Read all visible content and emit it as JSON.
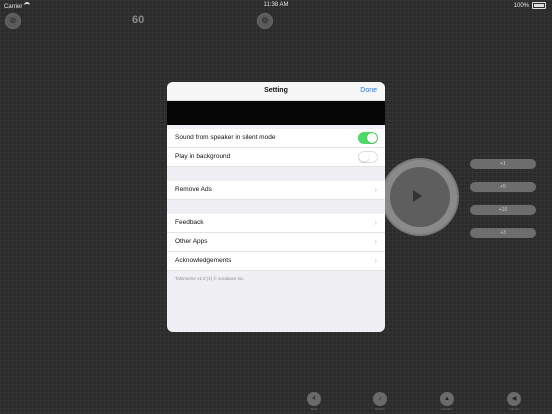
{
  "status_bar": {
    "carrier": "Carrier",
    "time": "11:38 AM",
    "battery": "100%"
  },
  "background": {
    "bpm": "60",
    "buttons": [
      "+1",
      "+5",
      "+10",
      "+3"
    ],
    "bottom_bar": [
      {
        "icon": "4",
        "label": "Beat"
      },
      {
        "icon": "♪",
        "label": "Rhythm"
      },
      {
        "icon": "▲",
        "label": "Variation"
      },
      {
        "icon": "◀",
        "label": "Volume"
      }
    ]
  },
  "settings": {
    "title": "Setting",
    "done_label": "Done",
    "rows": {
      "silent_mode": {
        "label": "Sound from speaker in silent mode",
        "enabled": true
      },
      "background_play": {
        "label": "Play in background",
        "enabled": false
      },
      "remove_ads": "Remove Ads",
      "feedback": "Feedback",
      "other_apps": "Other Apps",
      "acknowledgements": "Acknowledgements"
    },
    "footer": "Taktmeme v1.0 (4) © sorakaze inc."
  },
  "colors": {
    "accent": "#1a7cf5",
    "toggle_on": "#4cd964"
  }
}
